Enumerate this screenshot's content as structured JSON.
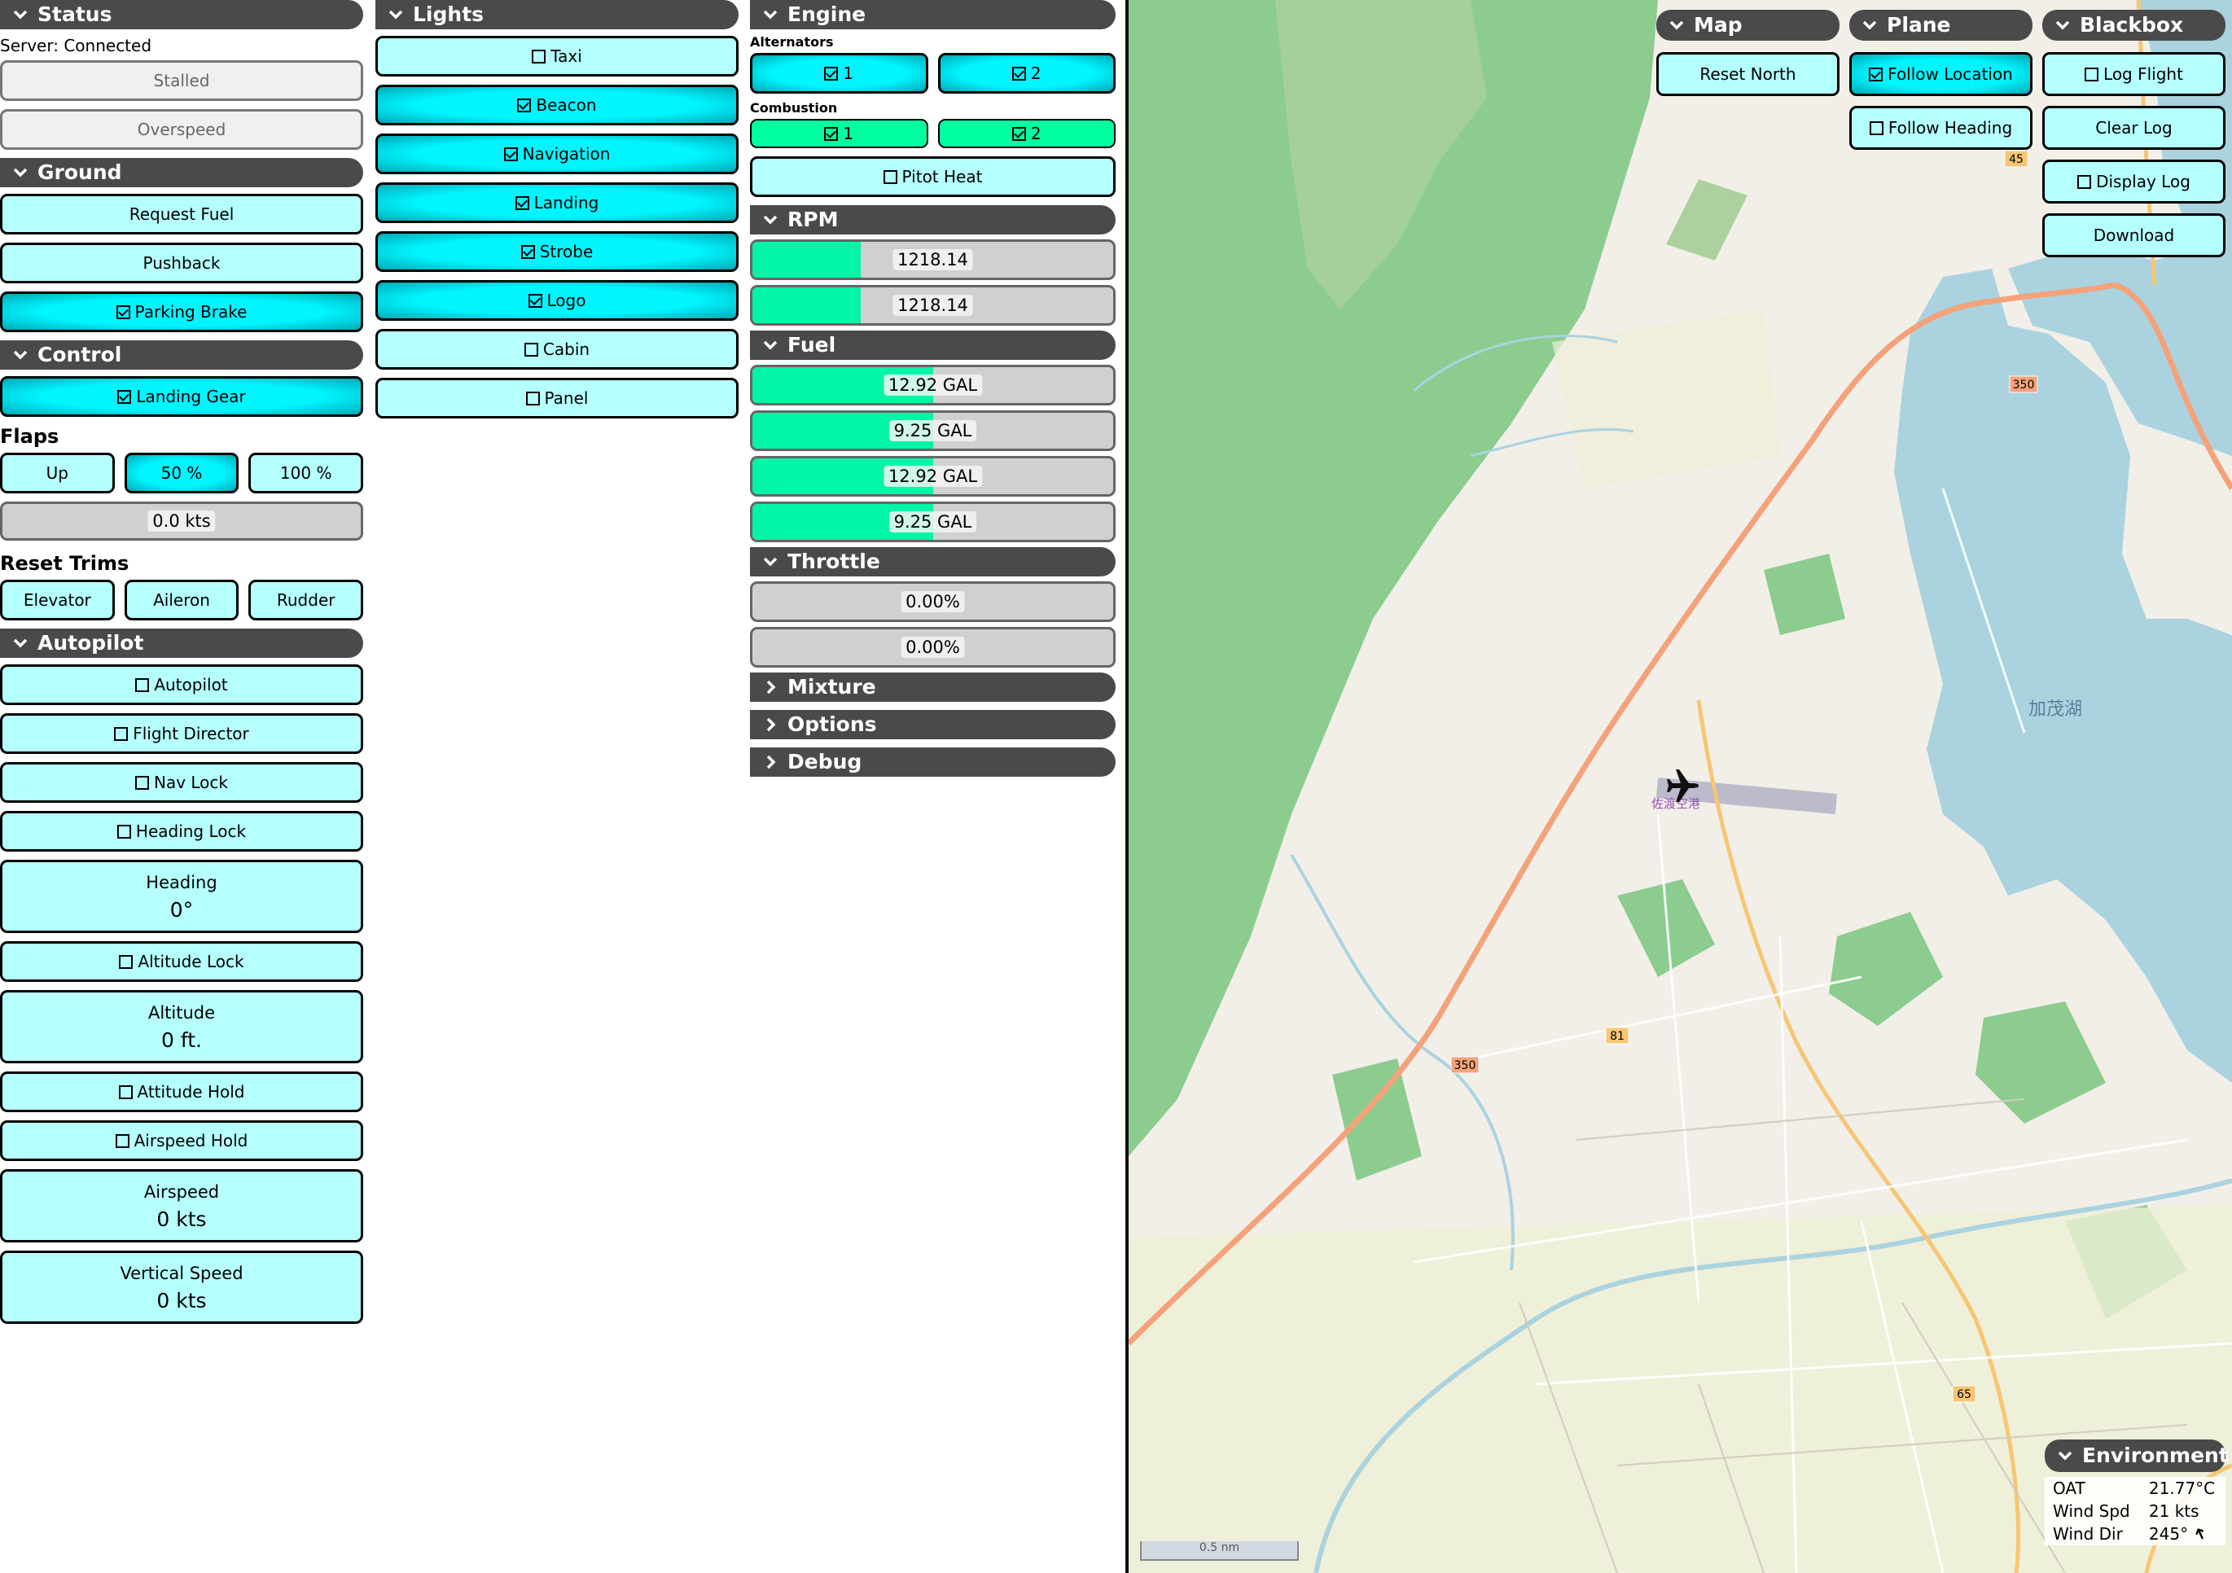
{
  "status": {
    "header": "Status",
    "server": "Server: Connected",
    "stalled": "Stalled",
    "overspeed": "Overspeed"
  },
  "ground": {
    "header": "Ground",
    "request_fuel": "Request Fuel",
    "pushback": "Pushback",
    "parking_brake": "Parking Brake"
  },
  "control": {
    "header": "Control",
    "landing_gear": "Landing Gear",
    "flaps_label": "Flaps",
    "flaps_up": "Up",
    "flaps_50": "50 %",
    "flaps_100": "100 %",
    "speed": "0.0 kts",
    "reset_trims": "Reset Trims",
    "elevator": "Elevator",
    "aileron": "Aileron",
    "rudder": "Rudder"
  },
  "autopilot": {
    "header": "Autopilot",
    "autopilot": "Autopilot",
    "flight_director": "Flight Director",
    "nav_lock": "Nav Lock",
    "heading_lock": "Heading Lock",
    "heading_label": "Heading",
    "heading_value": "0°",
    "altitude_lock": "Altitude Lock",
    "altitude_label": "Altitude",
    "altitude_value": "0 ft.",
    "attitude_hold": "Attitude Hold",
    "airspeed_hold": "Airspeed Hold",
    "airspeed_label": "Airspeed",
    "airspeed_value": "0 kts",
    "vs_label": "Vertical Speed",
    "vs_value": "0 kts"
  },
  "lights": {
    "header": "Lights",
    "taxi": "Taxi",
    "beacon": "Beacon",
    "navigation": "Navigation",
    "landing": "Landing",
    "strobe": "Strobe",
    "logo": "Logo",
    "cabin": "Cabin",
    "panel": "Panel"
  },
  "engine": {
    "header": "Engine",
    "alternators": "Alternators",
    "alt1": "1",
    "alt2": "2",
    "combustion": "Combustion",
    "comb1": "1",
    "comb2": "2",
    "pitot_heat": "Pitot Heat"
  },
  "rpm": {
    "header": "RPM",
    "rpm1": "1218.14",
    "rpm2": "1218.14",
    "rpm1_fraction": 0.3,
    "rpm2_fraction": 0.3
  },
  "fuel": {
    "header": "Fuel",
    "t1": "12.92 GAL",
    "t2": "9.25 GAL",
    "t3": "12.92 GAL",
    "t4": "9.25 GAL",
    "t1_fraction": 0.5,
    "t2_fraction": 0.5,
    "t3_fraction": 0.5,
    "t4_fraction": 0.5
  },
  "throttle": {
    "header": "Throttle",
    "t1": "0.00%",
    "t2": "0.00%"
  },
  "collapsed": {
    "mixture": "Mixture",
    "options": "Options",
    "debug": "Debug"
  },
  "map": {
    "header": "Map",
    "reset_north": "Reset North"
  },
  "plane": {
    "header": "Plane",
    "follow_location": "Follow Location",
    "follow_heading": "Follow Heading"
  },
  "blackbox": {
    "header": "Blackbox",
    "log_flight": "Log Flight",
    "clear_log": "Clear Log",
    "display_log": "Display Log",
    "download": "Download"
  },
  "environment": {
    "header": "Environment",
    "oat_label": "OAT",
    "oat": "21.77°C",
    "wind_spd_label": "Wind Spd",
    "wind_spd": "21 kts",
    "wind_dir_label": "Wind Dir",
    "wind_dir": "245°"
  },
  "map_labels": {
    "airport": "佐渡空港",
    "lake": "加茂湖",
    "scale": "0.5 nm",
    "route350a": "350",
    "route350b": "350",
    "route81": "81",
    "route45": "45",
    "route65": "65"
  },
  "colors": {
    "button": "#b5ffff",
    "active": "#00f5ff",
    "gauge": "#00f5a6",
    "header": "#4a4a4a",
    "water": "#aad3df",
    "forest": "#8ccc8f"
  }
}
